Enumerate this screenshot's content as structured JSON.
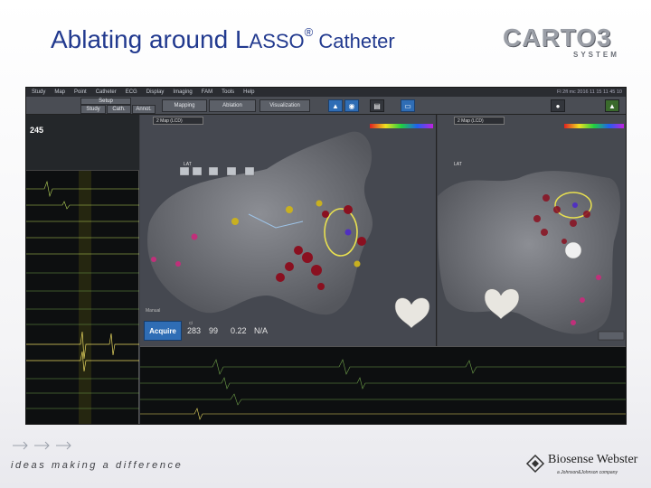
{
  "slide": {
    "title_first": "Ablating around ",
    "title_L": "L",
    "title_asso": "ASSO",
    "title_reg": "®",
    "title_rest": " Catheter",
    "carto_logo": "CARTO3",
    "carto_sub": "SYSTEM",
    "tagline": "ideas making a difference",
    "bw_logo": "Biosense Webster",
    "bw_sub": "a Johnson&Johnson company"
  },
  "app": {
    "menu": [
      "Study",
      "Map",
      "Point",
      "Catheter",
      "ECG",
      "Display",
      "Imaging",
      "FAM",
      "Tools",
      "Help"
    ],
    "file_info": "Fl 2fl mc 2016 11 15 11 45 10",
    "toolbar_buttons": [
      "Setup",
      "Study",
      "Cath.",
      "Annot.",
      "Mapping",
      "Ablation",
      "Visualization"
    ],
    "left_view_select": "2 Map (LCD)",
    "right_view_select": "2 Map (LCD)",
    "lat_label": "LAT",
    "signal_header_value": "245",
    "manual_label": "Manual",
    "acquire_label": "Acquire",
    "readouts": [
      {
        "label": "Cl",
        "value": "283"
      },
      {
        "label": "",
        "value": "99"
      },
      {
        "label": "",
        "value": "0.22"
      },
      {
        "label": "",
        "value": "N/A"
      }
    ],
    "icons": [
      "map-icon",
      "ablation-icon",
      "settings-icon",
      "sync-icon",
      "camera-icon",
      "warning-icon"
    ]
  }
}
